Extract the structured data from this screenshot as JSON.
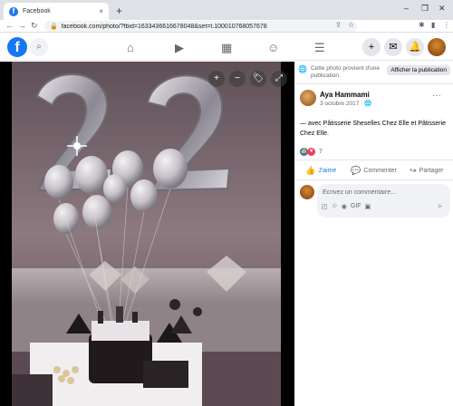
{
  "browser": {
    "tab_title": "Facebook",
    "tab_favicon": "f",
    "tab_close": "×",
    "new_tab": "+",
    "min": "–",
    "restore": "❐",
    "close": "✕",
    "back": "←",
    "forward": "→",
    "reload": "↻",
    "url": "facebook.com/photo/?fbid=1633436616678048&set=t.100010768057678"
  },
  "icons": {
    "lock": "🔒",
    "share": "⇪",
    "star": "☆",
    "extensions": "✱",
    "sidepanel": "▮",
    "search": "⌕",
    "home": "⌂",
    "video": "▶",
    "marketplace": "▦",
    "groups": "☺",
    "menu": "☰",
    "plus": "+",
    "messenger": "✉",
    "bell": "🔔",
    "zoom_in": "+",
    "zoom_out": "−",
    "tag": "🏷",
    "fullscreen": "⤢",
    "globe": "🌐",
    "more": "···",
    "like": "👍",
    "comment": "💬",
    "share_post": "↪",
    "love": "♥",
    "send": "➤",
    "sticker": "◰",
    "emoji": "☺",
    "camera": "◉",
    "gif": "GIF",
    "sticker2": "▣"
  },
  "fb": {
    "logo": "f"
  },
  "side": {
    "note": "Cette photo provient d'une publication.",
    "show_pub": "Afficher la publication",
    "author": "Aya Hammami",
    "date": "3 octobre 2017 · 🌐",
    "caption": "— avec Pâtisserie Sheselles Chez Elle et Pâtisserie Chez Elle.",
    "reaction_count": "7",
    "like_label": "J'aime",
    "comment_label": "Commenter",
    "share_label": "Partager",
    "comment_placeholder": "Écrivez un commentaire…"
  },
  "colors": {
    "fb_blue": "#1877f2",
    "love_red": "#f33e58"
  }
}
